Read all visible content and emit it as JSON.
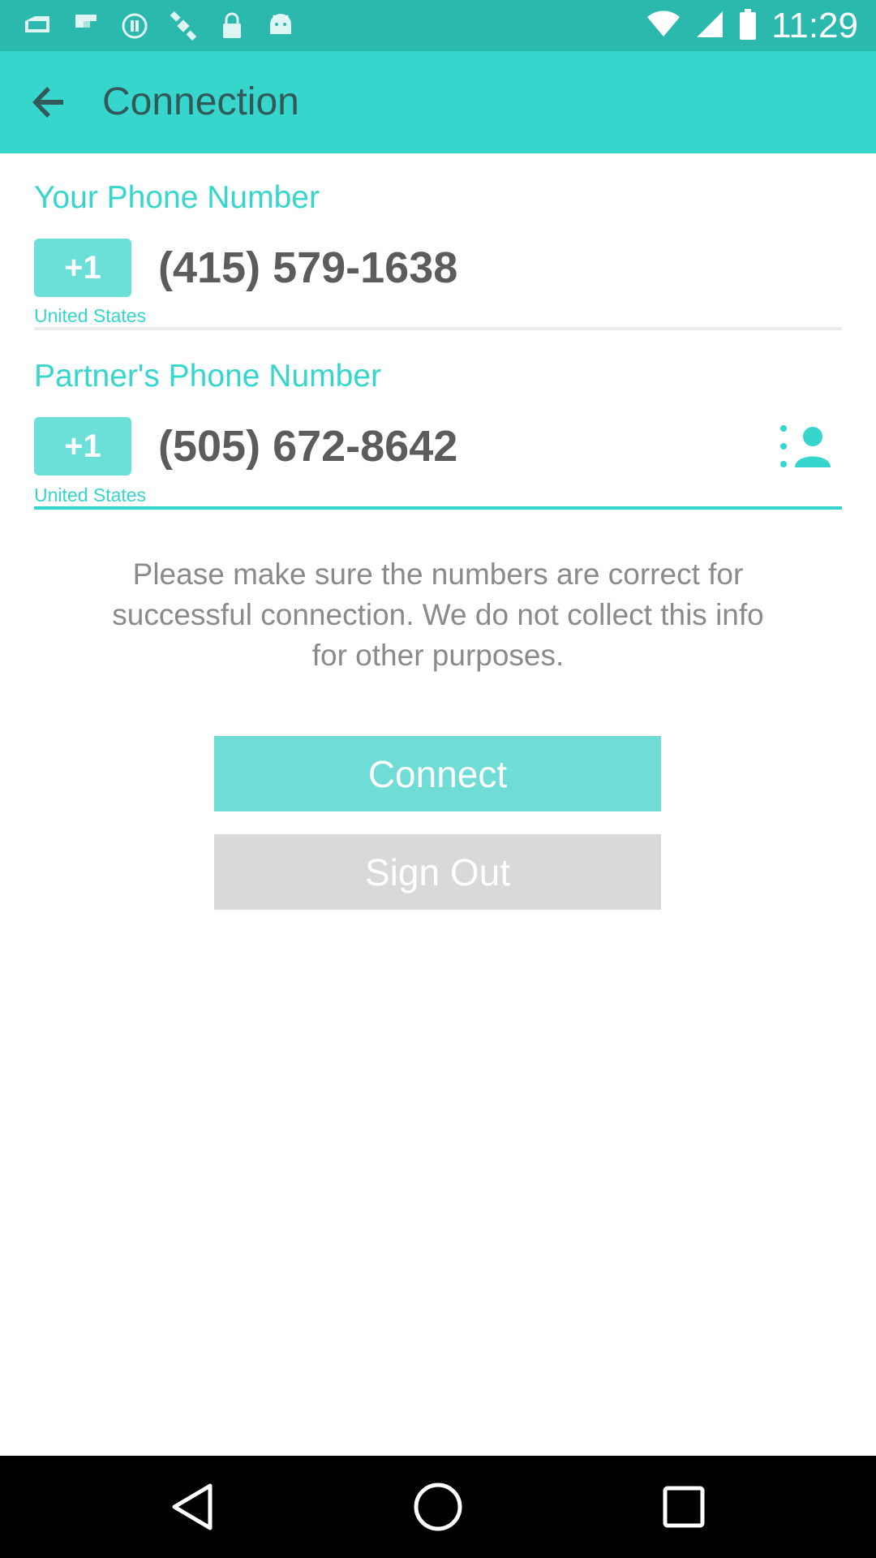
{
  "status_bar": {
    "time": "11:29",
    "icons": [
      "mail-icon",
      "flipboard-icon",
      "fake-gps-icon",
      "satellite-icon",
      "lock-icon",
      "android-icon",
      "wifi-icon",
      "cellular-signal-icon",
      "battery-icon"
    ]
  },
  "app_bar": {
    "title": "Connection",
    "back_icon": "back-arrow-icon"
  },
  "your_phone": {
    "label": "Your Phone Number",
    "country_code": "+1",
    "number": "(415) 579-1638",
    "country": "United States"
  },
  "partner_phone": {
    "label": "Partner's Phone Number",
    "country_code": "+1",
    "number": "(505) 672-8642",
    "country": "United States",
    "contact_icon": "contact-picker-icon"
  },
  "note": "Please make sure the numbers are correct for successful connection. We do not collect this info for other purposes.",
  "buttons": {
    "connect": "Connect",
    "sign_out": "Sign Out"
  },
  "colors": {
    "status_bar": "#2bb8ad",
    "app_bar": "#36d6cc",
    "accent": "#36d6cc",
    "connect_button": "#6fdcd5",
    "sign_out_button": "#d9d9d9"
  },
  "nav_bar": {
    "icons": [
      "back-triangle-icon",
      "home-circle-icon",
      "recents-square-icon"
    ]
  }
}
